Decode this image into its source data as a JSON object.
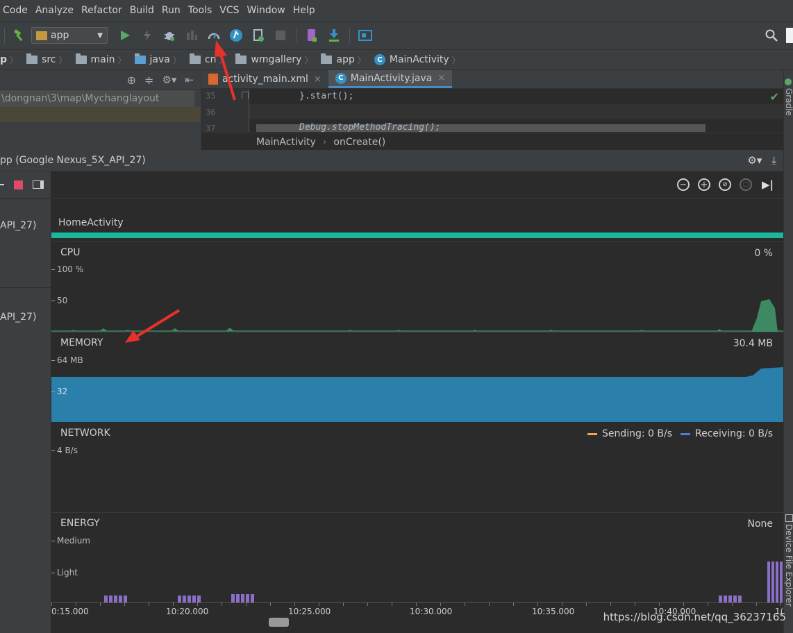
{
  "menu": [
    "Code",
    "Analyze",
    "Refactor",
    "Build",
    "Run",
    "Tools",
    "VCS",
    "Window",
    "Help"
  ],
  "toolbar": {
    "run_config": "app",
    "icons": [
      "hammer-icon",
      "run-icon",
      "apply-changes-icon",
      "debug-icon",
      "attach-debugger-icon",
      "profiler-icon",
      "firebase-icon",
      "sync-icon",
      "stop-icon",
      "avd-manager-icon",
      "sdk-manager-icon",
      "project-structure-icon",
      "search-icon"
    ]
  },
  "breadcrumb": [
    "p",
    "src",
    "main",
    "java",
    "cn",
    "wmgallery",
    "app",
    "MainActivity"
  ],
  "project": {
    "path": "\\dongnan\\3\\map\\Mychanglayout"
  },
  "editor": {
    "tabs": [
      {
        "label": "activity_main.xml",
        "close": "×"
      },
      {
        "label": "MainActivity.java",
        "close": "×"
      }
    ],
    "lines": [
      {
        "num": "35",
        "code": "}.start();"
      },
      {
        "num": "36",
        "code": ""
      },
      {
        "num": "37",
        "code": "Debug.stopMethodTracing();"
      }
    ],
    "crumbs": [
      "MainActivity",
      "onCreate()"
    ],
    "crumb_sep": "›"
  },
  "side_tabs": {
    "gradle": "Gradle",
    "device_explorer": "Device File Explorer"
  },
  "profiler": {
    "title": "pp (Google Nexus_5X_API_27)",
    "sessions": [
      "API_27)",
      "API_27)"
    ],
    "activity": "HomeActivity",
    "colors": {
      "activity_bar": "#19b79b",
      "cpu": "#3d8a62",
      "memory": "#2a7fab",
      "energy": "#8b6fc7",
      "sending": "#f0a35c",
      "receiving": "#4a7fd4"
    },
    "cpu": {
      "title": "CPU",
      "value": "0 %",
      "ticks": [
        "100 %",
        "50"
      ]
    },
    "memory": {
      "title": "MEMORY",
      "value": "30.4 MB",
      "ticks": [
        "64 MB",
        "32"
      ]
    },
    "network": {
      "title": "NETWORK",
      "sending": "Sending: 0 B/s",
      "receiving": "Receiving: 0 B/s",
      "ticks": [
        "4 B/s"
      ]
    },
    "energy": {
      "title": "ENERGY",
      "value": "None",
      "ticks": [
        "Medium",
        "Light"
      ]
    },
    "timeline": [
      "0:15.000",
      "10:20.000",
      "10:25.000",
      "10:30.000",
      "10:35.000",
      "10:40.000",
      "1("
    ]
  },
  "watermark": "https://blog.csdn.net/qq_36237165"
}
